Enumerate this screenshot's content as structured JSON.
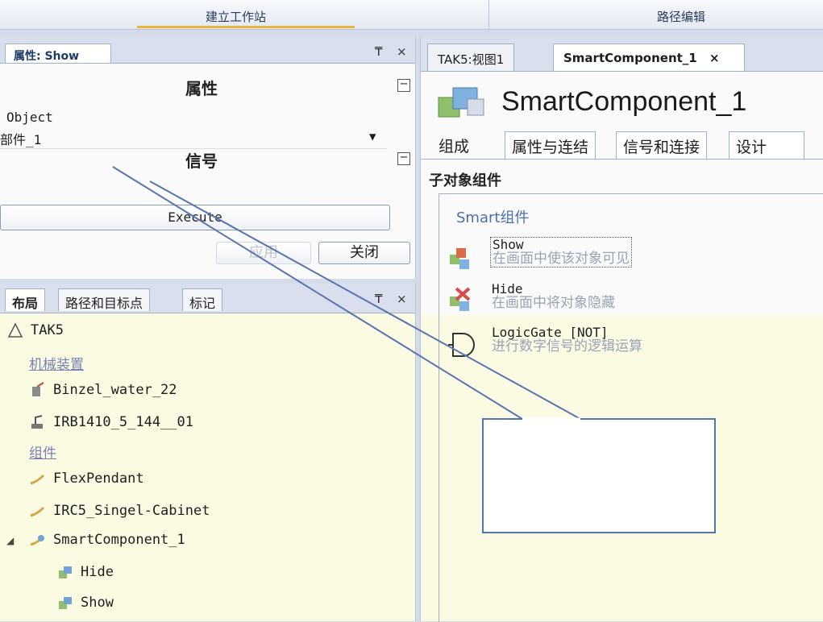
{
  "topbar": {
    "left_title": "建立工作站",
    "right_title": "路径编辑"
  },
  "properties_panel": {
    "tab_title": "属性: Show",
    "pin_glyph": "₸",
    "close_glyph": "×",
    "section_properties": "属性",
    "collapse_glyph": "−",
    "object_label": "Object",
    "object_value": "部件_1",
    "dropdown_glyph": "▼",
    "section_signals": "信号",
    "execute_label": "Execute",
    "apply_label": "应用",
    "close_label": "关闭"
  },
  "layout_panel": {
    "tabs": [
      "布局",
      "路径和目标点",
      "标记"
    ],
    "pin_glyph": "₸",
    "close_glyph": "×",
    "station": "TAK5",
    "group_mechanisms": "机械装置",
    "mechanisms": [
      "Binzel_water_22",
      "IRB1410_5_144__01"
    ],
    "group_components": "组件",
    "components": [
      "FlexPendant",
      "IRC5_Singel-Cabinet",
      "SmartComponent_1"
    ],
    "smart_children": [
      "Hide",
      "Show"
    ],
    "expand_glyph": "◢"
  },
  "right_panel": {
    "tabs": [
      "TAK5:视图1",
      "SmartComponent_1"
    ],
    "tab_close_glyph": "×",
    "title": "SmartComponent_1",
    "subtabs": [
      "组成",
      "属性与连结",
      "信号和连接",
      "设计"
    ],
    "sub_heading": "子对象组件",
    "group_title": "Smart组件",
    "components": [
      {
        "name": "Show",
        "desc": "在画面中使该对象可见"
      },
      {
        "name": "Hide",
        "desc": "在画面中将对象隐藏"
      },
      {
        "name": "LogicGate [NOT]",
        "desc": "进行数字信号的逻辑运算"
      }
    ]
  },
  "colors": {
    "accent": "#4a6fb5",
    "callout_border": "#5575b0",
    "highlight": "#fbfbe4"
  }
}
